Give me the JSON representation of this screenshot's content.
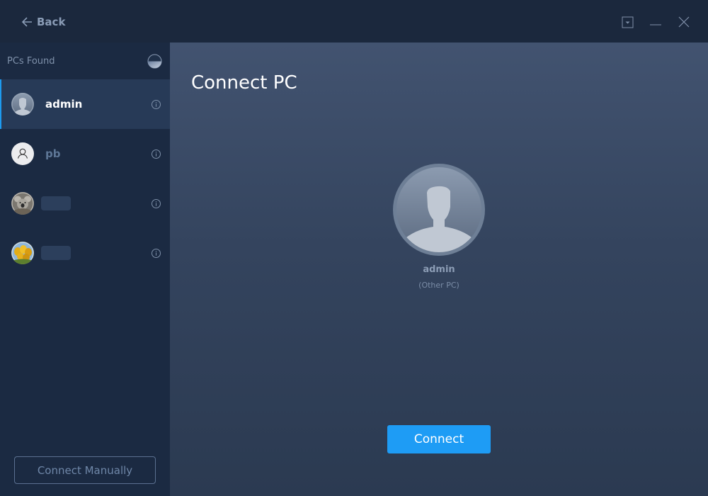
{
  "titlebar": {
    "back_label": "Back",
    "controls": {
      "dropdown_icon": "dropdown-box-icon",
      "minimize_icon": "minimize-icon",
      "close_icon": "close-icon"
    }
  },
  "sidebar": {
    "title": "PCs Found",
    "status_icon": "loading-spinner-icon",
    "items": [
      {
        "name": "admin",
        "avatar": "default-user-avatar",
        "active": true,
        "info_icon": "info-icon"
      },
      {
        "name": "pb",
        "avatar": "outline-user-avatar",
        "active": false,
        "info_icon": "info-icon"
      },
      {
        "name": "",
        "avatar": "koala-photo-avatar",
        "active": false,
        "redacted": true,
        "info_icon": "info-icon"
      },
      {
        "name": "",
        "avatar": "tulips-photo-avatar",
        "active": false,
        "redacted": true,
        "info_icon": "info-icon"
      }
    ],
    "manual_button_label": "Connect Manually"
  },
  "main": {
    "title": "Connect PC",
    "selected_pc": {
      "name": "admin",
      "type": "(Other PC)"
    },
    "connect_button_label": "Connect"
  },
  "colors": {
    "accent": "#1e9cf5",
    "sidebar_bg": "#1b2a42",
    "active_item_bg": "#273a57",
    "title_text": "#ffffff",
    "muted_text": "#7f91aa"
  }
}
